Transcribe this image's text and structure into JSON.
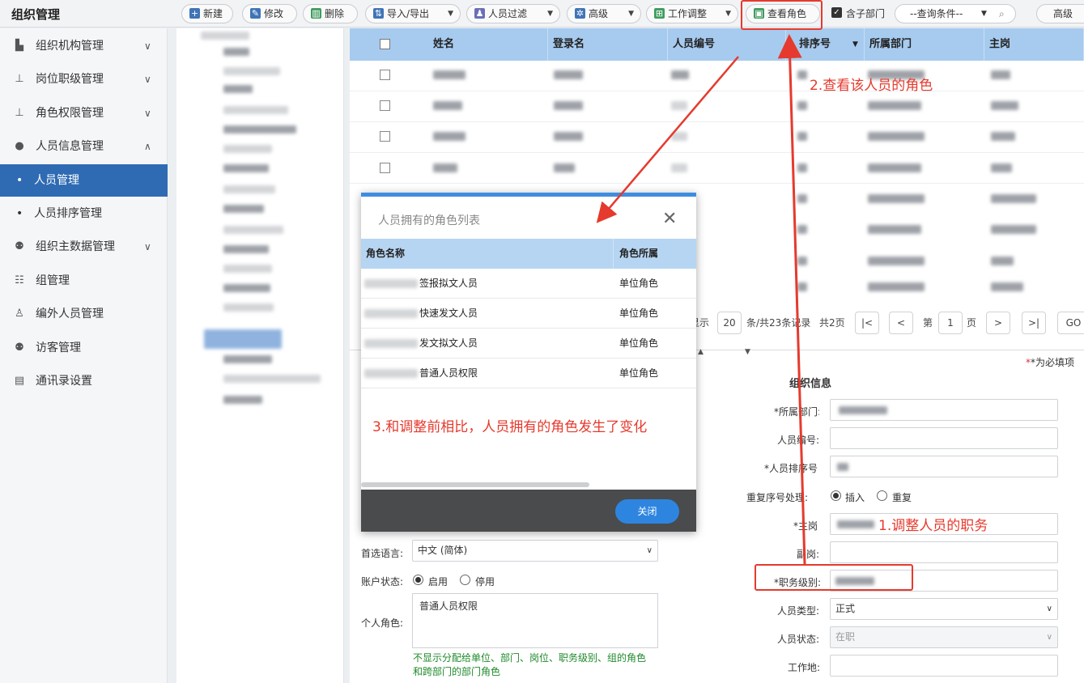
{
  "app_title": "组织管理",
  "toolbar": {
    "new": "新建",
    "edit": "修改",
    "delete": "删除",
    "import_export": "导入/导出",
    "person_filter": "人员过滤",
    "advanced": "高级",
    "work_adjust": "工作调整",
    "view_roles": "查看角色",
    "include_sub": "含子部门",
    "query_placeholder": "--查询条件--",
    "advanced_right": "高级"
  },
  "sidebar": {
    "items": [
      {
        "label": "组织机构管理",
        "icon": "org-structure-icon"
      },
      {
        "label": "岗位职级管理",
        "icon": "position-icon"
      },
      {
        "label": "角色权限管理",
        "icon": "role-icon"
      },
      {
        "label": "人员信息管理",
        "icon": "person-icon"
      },
      {
        "label": "人员管理",
        "icon": "dot"
      },
      {
        "label": "人员排序管理",
        "icon": "dot"
      },
      {
        "label": "组织主数据管理",
        "icon": "master-data-icon"
      },
      {
        "label": "组管理",
        "icon": "group-icon"
      },
      {
        "label": "编外人员管理",
        "icon": "external-person-icon"
      },
      {
        "label": "访客管理",
        "icon": "visitor-icon"
      },
      {
        "label": "通讯录设置",
        "icon": "contacts-icon"
      }
    ]
  },
  "grid": {
    "columns": [
      "姓名",
      "登录名",
      "人员编号",
      "排序号",
      "所属部门",
      "主岗"
    ]
  },
  "pager": {
    "show": "显示",
    "page_size": "20",
    "summary": "条/共23条记录",
    "total_pages": "共2页",
    "first": "|<",
    "prev": "<",
    "page_prefix": "第",
    "page_num": "1",
    "page_suffix": "页",
    "next": ">",
    "last": ">|",
    "go": "GO"
  },
  "form": {
    "required_note": "*为必填项",
    "section_title": "组织信息",
    "dept_label": "*所属部门:",
    "person_no_label": "人员编号:",
    "person_sort_label": "*人员排序号:",
    "dup_label": "重复序号处理:",
    "dup_insert": "插入",
    "dup_repeat": "重复",
    "main_post_label": "*主岗:",
    "sub_post_label": "副岗:",
    "job_level_label": "*职务级别:",
    "person_type_label": "人员类型:",
    "person_type_value": "正式",
    "person_status_label": "人员状态:",
    "person_status_value": "在职",
    "work_place_label": "工作地:",
    "lang_label": "首选语言:",
    "lang_value": "中文 (简体)",
    "account_label": "账户状态:",
    "account_enable": "启用",
    "account_disable": "停用",
    "personal_role_label": "个人角色:",
    "personal_role_value": "普通人员权限",
    "role_note_line1": "不显示分配给单位、部门、岗位、职务级别、组的角色",
    "role_note_line2": "和跨部门的部门角色"
  },
  "modal": {
    "title": "人员拥有的角色列表",
    "col_name": "角色名称",
    "col_belong": "角色所属",
    "rows": [
      {
        "name": "签报拟文人员",
        "belong": "单位角色"
      },
      {
        "name": "快速发文人员",
        "belong": "单位角色"
      },
      {
        "name": "发文拟文人员",
        "belong": "单位角色"
      },
      {
        "name": "普通人员权限",
        "belong": "单位角色"
      }
    ],
    "close": "关闭"
  },
  "annotations": {
    "step1": "1.调整人员的职务",
    "step2": "2.查看该人员的角色",
    "step3": "3.和调整前相比，人员拥有的角色发生了变化"
  },
  "colors": {
    "accent": "#2f6bb3",
    "annotation": "#e53a2d",
    "grid_header": "#a7cbef"
  }
}
